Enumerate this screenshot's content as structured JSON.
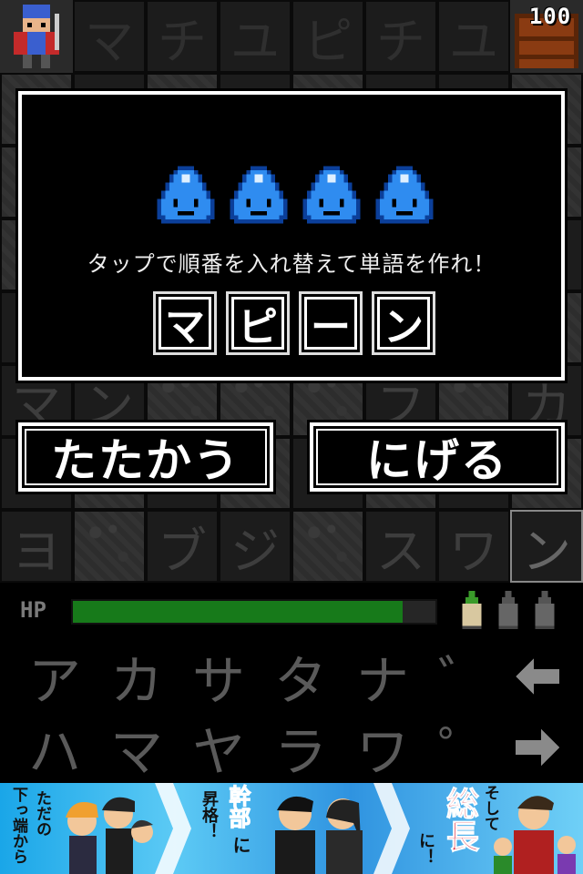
{
  "board": {
    "rows": [
      [
        "",
        "マ",
        "チ",
        "ユ",
        "ピ",
        "チ",
        "ユ",
        ""
      ],
      [
        "",
        "",
        "",
        "",
        "",
        "",
        "",
        ""
      ],
      [
        "",
        "",
        "",
        "",
        "",
        "",
        "",
        ""
      ],
      [
        "",
        "",
        "",
        "",
        "",
        "",
        "",
        ""
      ],
      [
        "",
        "",
        "",
        "",
        "",
        "",
        "",
        ""
      ],
      [
        "マ",
        "ン",
        "",
        "",
        "",
        "フ",
        "",
        "カ"
      ],
      [
        "",
        "",
        "",
        "",
        "",
        "",
        "",
        ""
      ],
      [
        "ヨ",
        "",
        "ブ",
        "ジ",
        "",
        "ス",
        "ワ",
        "ン"
      ]
    ],
    "chest_count": "100"
  },
  "dialog": {
    "instruction": "タップで順番を入れ替えて単語を作れ！",
    "letters": [
      "マ",
      "ピ",
      "ー",
      "ン"
    ],
    "slime_count": 4
  },
  "actions": {
    "fight_label": "たたかう",
    "flee_label": "にげる"
  },
  "status": {
    "hp_label": "HP",
    "hp_fraction": 0.91,
    "potions_total": 3,
    "potions_available": 1
  },
  "keyboard": {
    "row1": [
      "ア",
      "カ",
      "サ",
      "タ",
      "ナ",
      "゛"
    ],
    "row2": [
      "ハ",
      "マ",
      "ヤ",
      "ラ",
      "ワ",
      "゜"
    ],
    "back_icon": "left-arrow-icon",
    "forward_icon": "right-arrow-icon"
  },
  "ad": {
    "text1": "ただの",
    "text2": "下っ端から",
    "text3": "幹部",
    "text4": "に",
    "text5": "昇格！",
    "text6": "そして",
    "text7": "総長",
    "text8": "に！"
  },
  "colors": {
    "hp_fill": "#177a1a",
    "slime_blue": "#2f8cf0",
    "ad_blue": "#1aa6e8"
  }
}
